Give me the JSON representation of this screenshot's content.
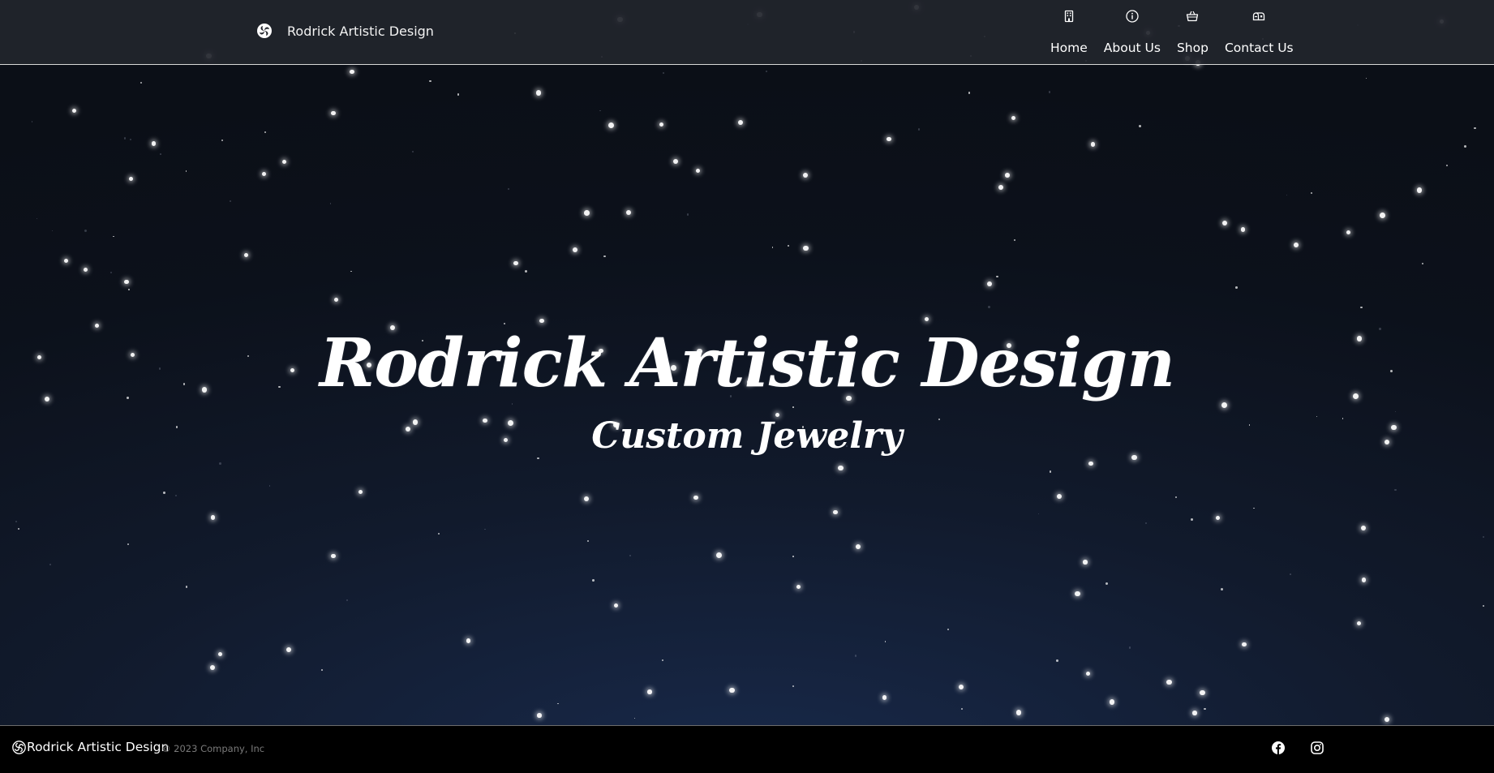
{
  "header": {
    "brand_name": "Rodrick Artistic Design",
    "brand_logo_icon": "swirl-logo-icon",
    "nav": [
      {
        "label": "Home",
        "icon": "building-icon"
      },
      {
        "label": "About Us",
        "icon": "info-circle-icon"
      },
      {
        "label": "Shop",
        "icon": "basket-icon"
      },
      {
        "label": "Contact Us",
        "icon": "mailbox-icon"
      }
    ]
  },
  "hero": {
    "title": "Rodrick Artistic Design",
    "subtitle": "Custom Jewelry"
  },
  "footer": {
    "brand_name": "Rodrick Artistic Design",
    "copyright": "© 2023 Company, Inc",
    "social": [
      {
        "name": "Facebook",
        "icon": "facebook-icon"
      },
      {
        "name": "Instagram",
        "icon": "instagram-icon"
      }
    ]
  },
  "colors": {
    "header_bg": "#22252c",
    "hero_bg_top": "#0c111b",
    "hero_bg_bottom": "#18294a",
    "footer_bg": "#000000",
    "text": "#ffffff",
    "muted_text": "#7a7a7a"
  }
}
